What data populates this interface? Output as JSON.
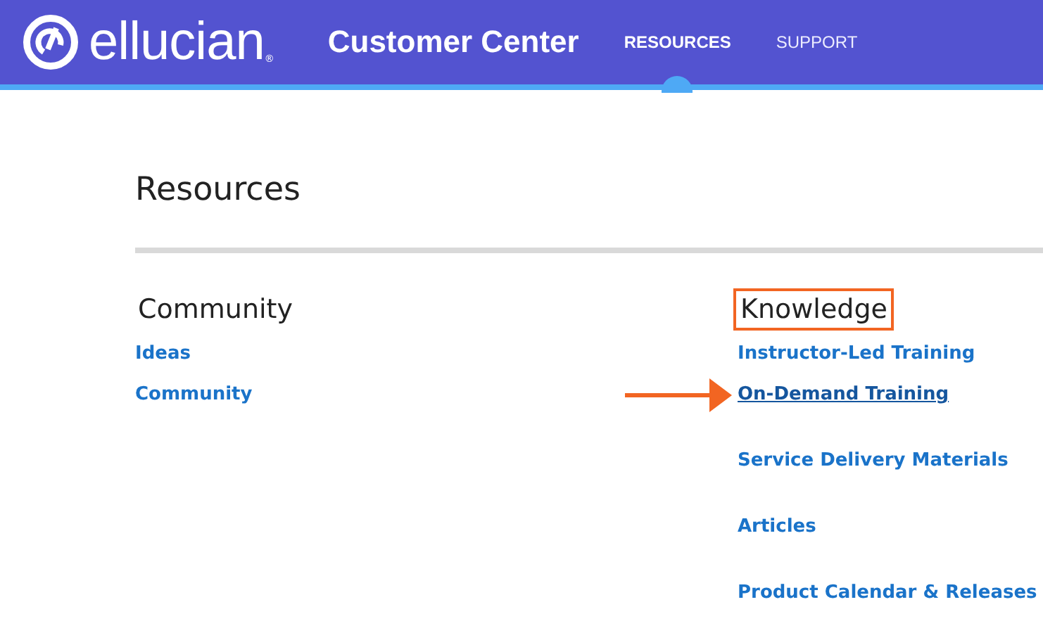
{
  "header": {
    "logo_text": "ellucian",
    "logo_mark": "®",
    "title": "Customer Center",
    "nav": [
      {
        "label": "RESOURCES",
        "selected": true
      },
      {
        "label": "SUPPORT",
        "selected": false
      }
    ]
  },
  "page_title": "Resources",
  "sections": [
    {
      "heading": "Community",
      "boxed": false,
      "links": [
        {
          "label": "Ideas",
          "underlined": false,
          "arrow": false
        },
        {
          "label": "Community",
          "underlined": false,
          "arrow": false
        }
      ]
    },
    {
      "heading": "Knowledge",
      "boxed": true,
      "links": [
        {
          "label": "Instructor-Led Training",
          "underlined": false,
          "arrow": false
        },
        {
          "label": "On-Demand Training",
          "underlined": true,
          "arrow": true
        },
        {
          "label": "Service Delivery Materials",
          "underlined": false,
          "arrow": false
        },
        {
          "label": "Articles",
          "underlined": false,
          "arrow": false
        },
        {
          "label": "Product Calendar & Releases",
          "underlined": false,
          "arrow": false
        }
      ]
    }
  ]
}
